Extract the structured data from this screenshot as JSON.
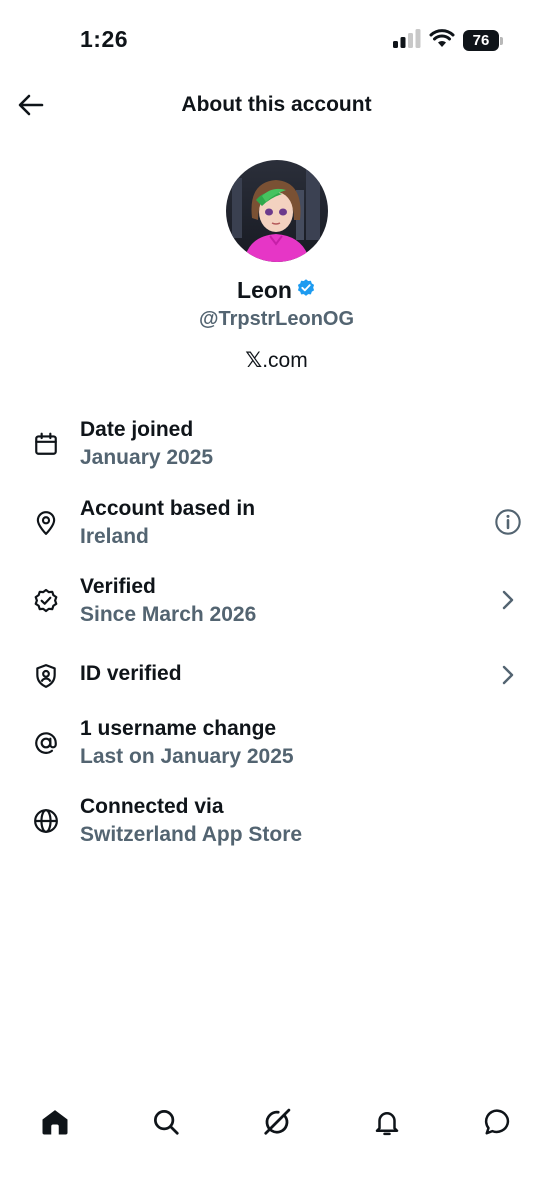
{
  "status_bar": {
    "time": "1:26",
    "battery_level": "76",
    "signal_icon": "cellular-signal-icon",
    "wifi_icon": "wifi-icon"
  },
  "header": {
    "title": "About this account",
    "back_icon": "arrow-left-icon"
  },
  "profile": {
    "name": "Leon",
    "verified_badge_color": "#1d9bf0",
    "handle": "@TrpstrLeonOG",
    "site_logo": "𝕏",
    "site_suffix": ".com"
  },
  "info_rows": [
    {
      "icon": "calendar-icon",
      "title": "Date joined",
      "subtitle": "January 2025",
      "trailing": ""
    },
    {
      "icon": "location-pin-icon",
      "title": "Account based in",
      "subtitle": "Ireland",
      "trailing": "info-icon"
    },
    {
      "icon": "verified-badge-icon",
      "title": "Verified",
      "subtitle": "Since March 2026",
      "trailing": "chevron-right-icon"
    },
    {
      "icon": "id-shield-icon",
      "title": "ID verified",
      "subtitle": "",
      "trailing": "chevron-right-icon"
    },
    {
      "icon": "at-sign-icon",
      "title": "1 username change",
      "subtitle": "Last on January 2025",
      "trailing": ""
    },
    {
      "icon": "globe-icon",
      "title": "Connected via",
      "subtitle": "Switzerland App Store",
      "trailing": ""
    }
  ],
  "tab_bar": {
    "tabs": [
      "home-icon",
      "search-icon",
      "grok-icon",
      "notifications-bell-icon",
      "messages-icon"
    ],
    "active": "home-icon"
  },
  "colors": {
    "text_primary": "#0f1419",
    "text_secondary": "#536471",
    "accent": "#1d9bf0"
  }
}
